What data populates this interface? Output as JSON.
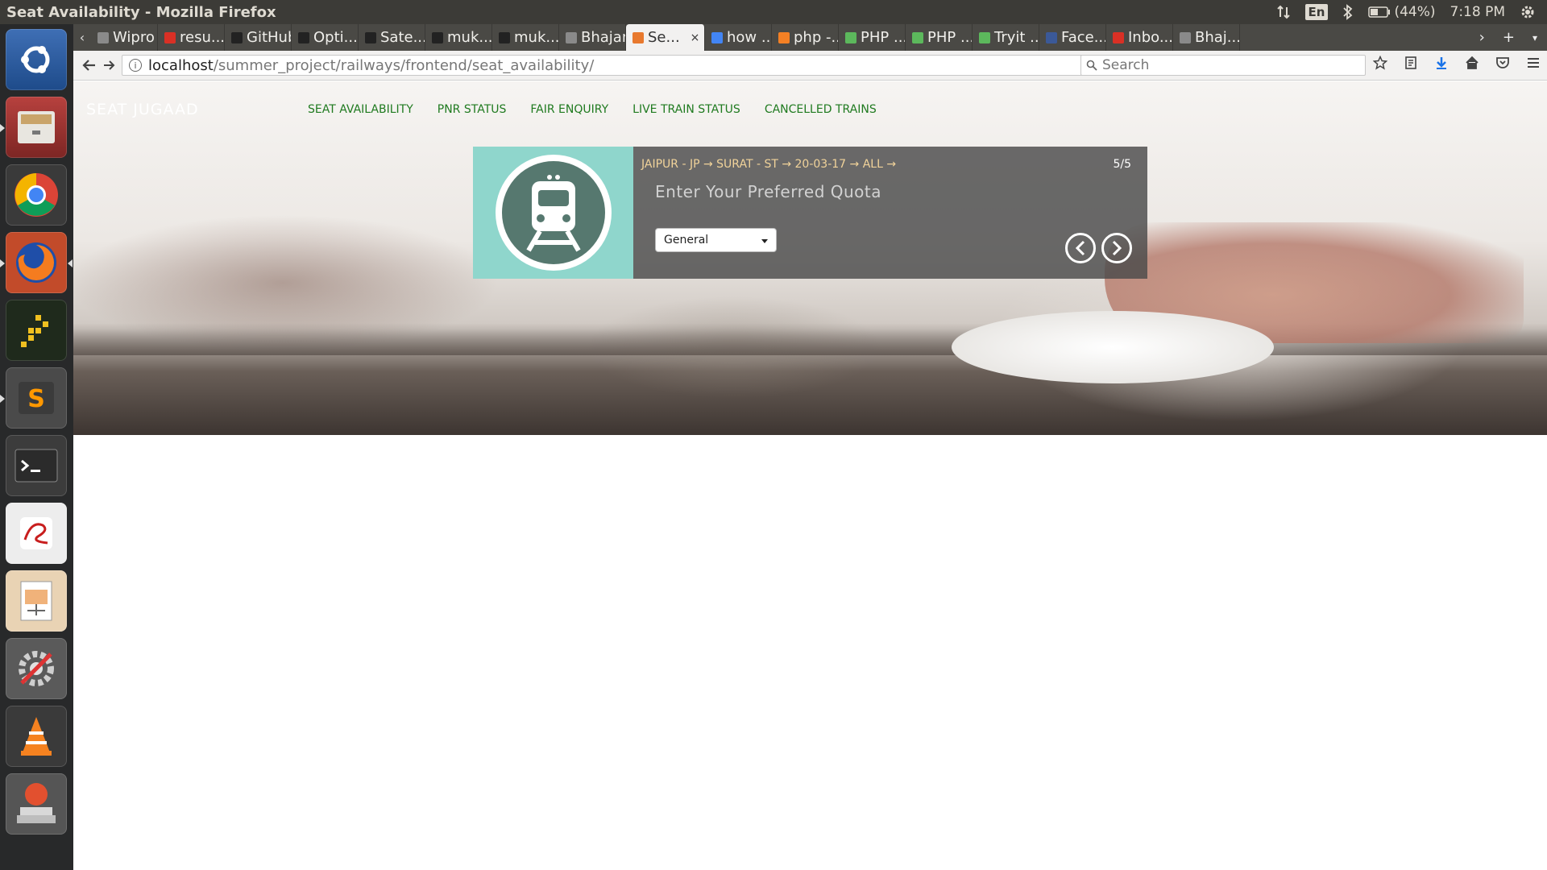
{
  "os": {
    "window_title": "Seat Availability - Mozilla Firefox",
    "tray": {
      "lang": "En",
      "battery": "(44%)",
      "clock": "7:18 PM"
    },
    "launcher": [
      "ubuntu-dash-icon",
      "files-icon",
      "chrome-icon",
      "firefox-icon",
      "app-grid-icon",
      "sublime-text-icon",
      "terminal-icon",
      "epdfview-icon",
      "impress-icon",
      "system-settings-icon",
      "vlc-icon",
      "installer-icon"
    ]
  },
  "browser": {
    "tabs": [
      {
        "label": "Wipro ...",
        "favicon_color": "#8a8a8a"
      },
      {
        "label": "resu...",
        "favicon_color": "#d93025"
      },
      {
        "label": "GitHub",
        "favicon_color": "#222222"
      },
      {
        "label": "Opti...",
        "favicon_color": "#222222"
      },
      {
        "label": "Sate...",
        "favicon_color": "#222222"
      },
      {
        "label": "muk...",
        "favicon_color": "#222222"
      },
      {
        "label": "muk...",
        "favicon_color": "#222222"
      },
      {
        "label": "Bhajan -...",
        "favicon_color": "#8a8a8a"
      },
      {
        "label": "Se...",
        "favicon_color": "#e8792e",
        "active": true
      },
      {
        "label": "how ...",
        "favicon_color": "#4285f4"
      },
      {
        "label": "php -...",
        "favicon_color": "#f48024"
      },
      {
        "label": "PHP ...",
        "favicon_color": "#5cb85c"
      },
      {
        "label": "PHP ...",
        "favicon_color": "#5cb85c"
      },
      {
        "label": "Tryit ...",
        "favicon_color": "#5cb85c"
      },
      {
        "label": "Face...",
        "favicon_color": "#3b5998"
      },
      {
        "label": "Inbo...",
        "favicon_color": "#d93025"
      },
      {
        "label": "Bhaj...",
        "favicon_color": "#8a8a8a"
      }
    ],
    "url_host": "localhost",
    "url_path": "/summer_project/railways/frontend/seat_availability/",
    "search_placeholder": "Search"
  },
  "site": {
    "brand": "SEAT JUGAAD",
    "nav": [
      "SEAT AVAILABILITY",
      "PNR STATUS",
      "FAIR ENQUIRY",
      "LIVE TRAIN STATUS",
      "CANCELLED TRAINS"
    ]
  },
  "form": {
    "breadcrumb": "JAIPUR - JP → SURAT - ST → 20-03-17 → ALL →",
    "step": "5/5",
    "question": "Enter Your Preferred Quota",
    "quota_selected": "General",
    "accent_color": "#8fd6cc",
    "nav_color": "#1f7a1f"
  }
}
